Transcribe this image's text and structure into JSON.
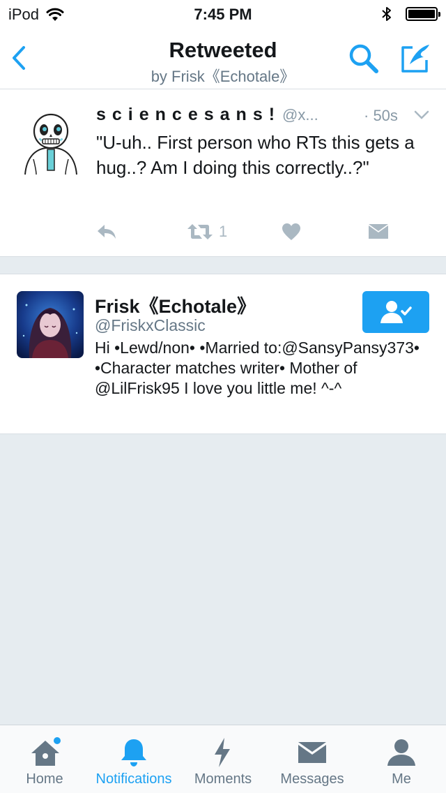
{
  "status_bar": {
    "device": "iPod",
    "time": "7:45 PM",
    "wifi_icon": "wifi-icon",
    "bluetooth_icon": "bluetooth-icon",
    "battery_icon": "battery-icon"
  },
  "nav": {
    "title": "Retweeted",
    "subtitle": "by Frisk《Echotale》",
    "back_icon": "chevron-left-icon",
    "search_icon": "search-icon",
    "compose_icon": "compose-icon"
  },
  "tweet": {
    "name": "sciencesans!",
    "handle": "@x...",
    "time": "· 50s",
    "text": "\"U-uh.. First person who RTs this gets a hug..? Am I doing this correctly..?\"",
    "retweet_count": "1",
    "avatar_icon": "sans-avatar"
  },
  "user": {
    "name": "Frisk《Echotale》",
    "handle": "@FriskxClassic",
    "bio": "Hi •Lewd/non• •Married to:@SansyPansy373• •Character matches writer• Mother of @LilFrisk95 I love you little me! ^-^",
    "follow_icon": "following-person-icon"
  },
  "tabs": [
    {
      "label": "Home",
      "icon": "home-icon",
      "active": false,
      "has_dot": true
    },
    {
      "label": "Notifications",
      "icon": "bell-icon",
      "active": true
    },
    {
      "label": "Moments",
      "icon": "lightning-icon",
      "active": false
    },
    {
      "label": "Messages",
      "icon": "envelope-icon",
      "active": false
    },
    {
      "label": "Me",
      "icon": "person-icon",
      "active": false
    }
  ],
  "colors": {
    "accent": "#1da1f2",
    "background": "#e6ecf0",
    "text": "#14171a",
    "secondary_text": "#657786",
    "action_gray": "#aab8c2"
  }
}
